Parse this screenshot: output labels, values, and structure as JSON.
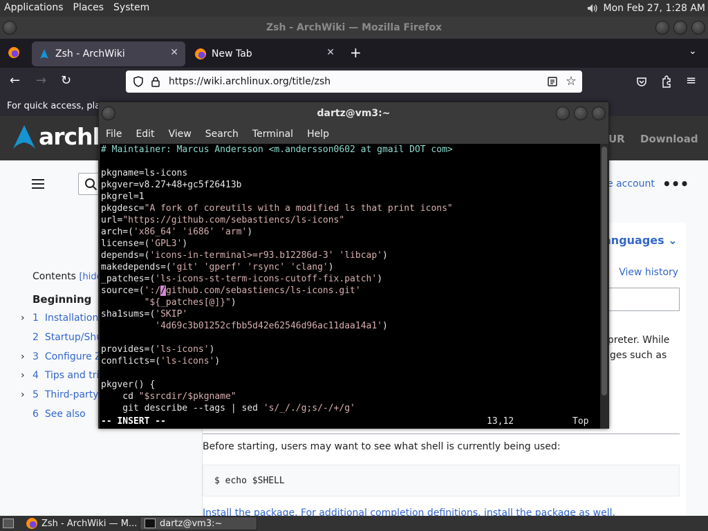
{
  "top_panel": {
    "menus": [
      "Applications",
      "Places",
      "System"
    ],
    "clock": "Mon Feb 27,  1:28 AM"
  },
  "firefox": {
    "window_title": "Zsh - ArchWiki — Mozilla Firefox",
    "tabs": [
      {
        "label": "Zsh - ArchWiki",
        "active": true
      },
      {
        "label": "New Tab",
        "active": false
      }
    ],
    "url": "https://wiki.archlinux.org/title/zsh",
    "bookmarks_hint": "For quick access, place"
  },
  "wiki": {
    "logo_text": "archli",
    "nav_aur": "UR",
    "nav_download": "Download",
    "create_account": "e account",
    "more": "•••",
    "languages": "anguages",
    "content_tabs": [
      "rce",
      "View history"
    ],
    "toc": {
      "title": "Contents",
      "hide": "[hide]",
      "beginning": "Beginning",
      "items": [
        {
          "num": "1",
          "label": "Installation",
          "expandable": true
        },
        {
          "num": "2",
          "label": "Startup/Shutc",
          "expandable": false
        },
        {
          "num": "3",
          "label": "Configure Zs",
          "expandable": true
        },
        {
          "num": "4",
          "label": "Tips and trick",
          "expandable": true
        },
        {
          "num": "5",
          "label": "Third-party ex",
          "expandable": true
        },
        {
          "num": "6",
          "label": "See also",
          "expandable": false
        }
      ]
    },
    "intro_line1": "terpreter. While",
    "intro_line2": "ntages such as",
    "before_starting": "Before starting, users may want to see what shell is currently being used:",
    "code": "$ echo $SHELL",
    "install_line": "Install the    package. For additional completion definitions, install the                    package as well."
  },
  "terminal": {
    "title": "dartz@vm3:~",
    "menu": [
      "File",
      "Edit",
      "View",
      "Search",
      "Terminal",
      "Help"
    ],
    "status_mode": "-- INSERT --",
    "status_pos": "13,12",
    "status_top": "Top"
  },
  "taskbar": {
    "tasks": [
      {
        "label": "Zsh - ArchWiki — M...",
        "icon": "firefox-icon"
      },
      {
        "label": "dartz@vm3:~",
        "icon": "terminal-icon"
      }
    ]
  }
}
